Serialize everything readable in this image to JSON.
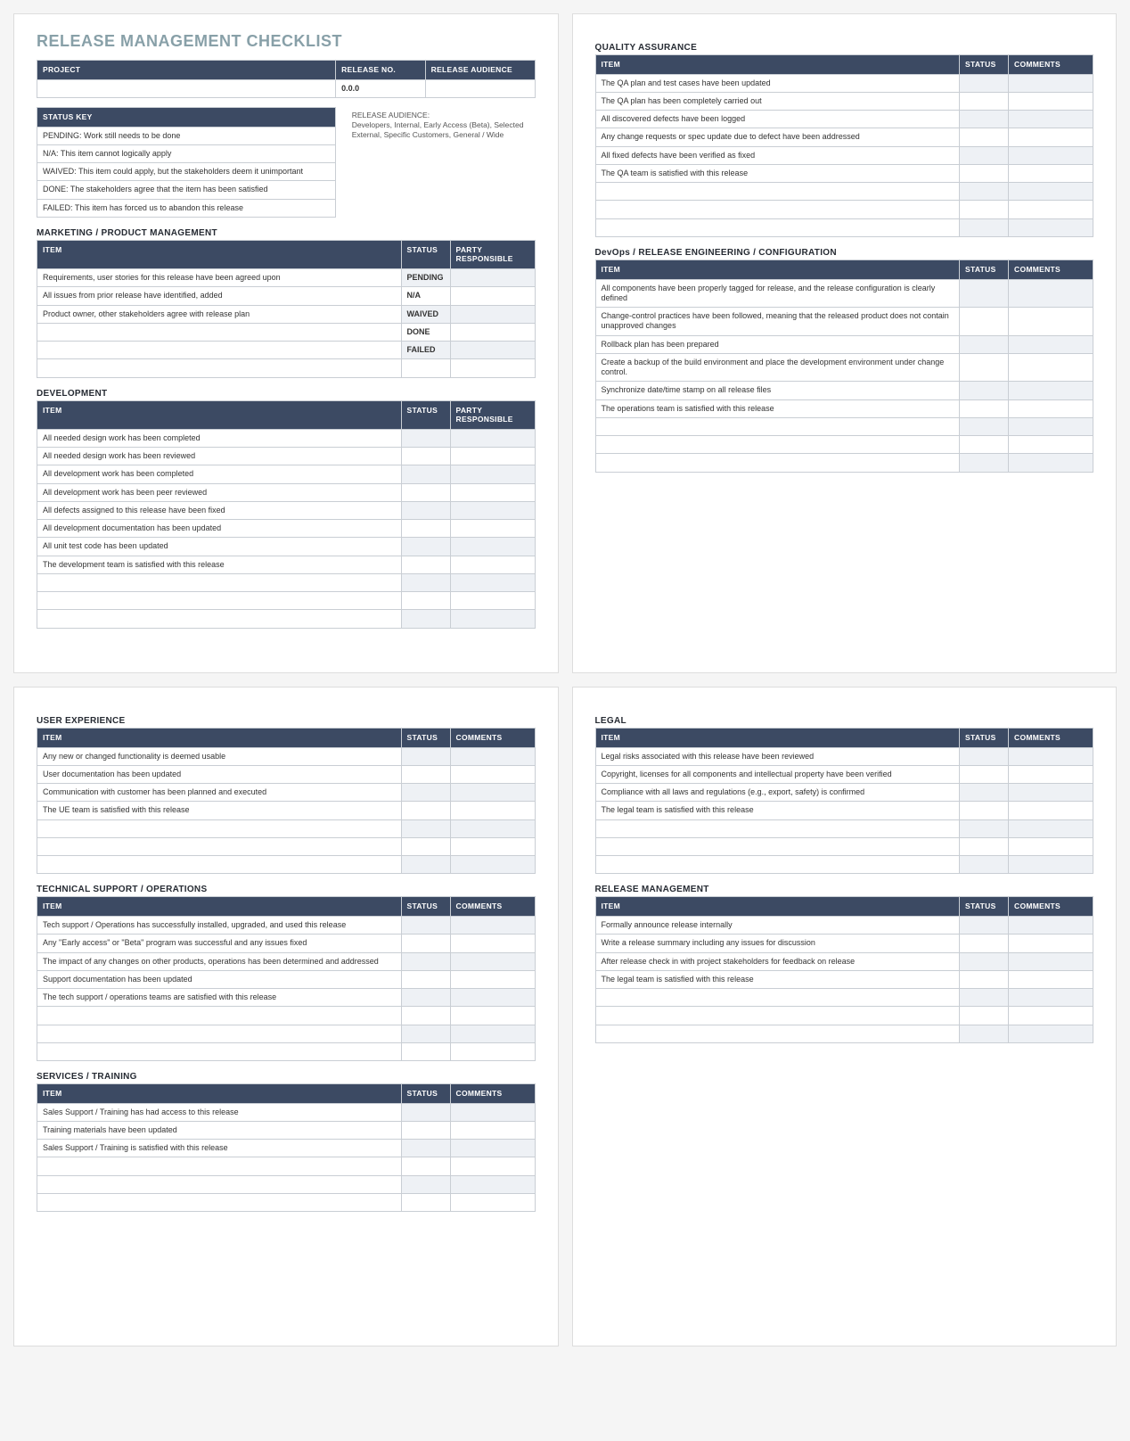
{
  "title": "RELEASE MANAGEMENT CHECKLIST",
  "project_table": {
    "headers": [
      "PROJECT",
      "RELEASE NO.",
      "RELEASE AUDIENCE"
    ],
    "row": [
      "",
      "0.0.0",
      ""
    ]
  },
  "status_key": {
    "header": "STATUS KEY",
    "rows": [
      "PENDING:  Work still needs to be done",
      "N/A:  This item cannot logically apply",
      "WAIVED:  This item could apply, but the stakeholders deem it unimportant",
      "DONE:  The stakeholders agree that the item has been satisfied",
      "FAILED:  This item has forced us to abandon this release"
    ]
  },
  "release_audience_note_label": "RELEASE AUDIENCE:",
  "release_audience_note": "Developers, Internal, Early Access (Beta), Selected External, Specific Customers, General / Wide",
  "col_item": "ITEM",
  "col_status": "STATUS",
  "col_party": "PARTY RESPONSIBLE",
  "col_comments": "COMMENTS",
  "sections": {
    "marketing": {
      "title": "MARKETING / PRODUCT MANAGEMENT",
      "third_col": "party",
      "rows": [
        [
          "Requirements, user stories for this release have been agreed upon",
          "PENDING",
          ""
        ],
        [
          "All issues from prior release have identified, added",
          "N/A",
          ""
        ],
        [
          "Product owner, other stakeholders agree with release plan",
          "WAIVED",
          ""
        ],
        [
          "",
          "DONE",
          ""
        ],
        [
          "",
          "FAILED",
          ""
        ],
        [
          "",
          "",
          ""
        ]
      ]
    },
    "development": {
      "title": "DEVELOPMENT",
      "third_col": "party",
      "rows": [
        [
          "All needed design work has been completed",
          "",
          ""
        ],
        [
          "All needed design work has been reviewed",
          "",
          ""
        ],
        [
          "All development work has been completed",
          "",
          ""
        ],
        [
          "All development work has been peer reviewed",
          "",
          ""
        ],
        [
          "All defects assigned to this release have been fixed",
          "",
          ""
        ],
        [
          "All development documentation has been updated",
          "",
          ""
        ],
        [
          "All unit test code has been updated",
          "",
          ""
        ],
        [
          "The development team is satisfied with this release",
          "",
          ""
        ],
        [
          "",
          "",
          ""
        ],
        [
          "",
          "",
          ""
        ],
        [
          "",
          "",
          ""
        ]
      ]
    },
    "qa": {
      "title": "QUALITY ASSURANCE",
      "third_col": "comments",
      "rows": [
        [
          "The QA plan and test cases have been updated",
          "",
          ""
        ],
        [
          "The QA plan has been completely carried out",
          "",
          ""
        ],
        [
          "All discovered defects have been logged",
          "",
          ""
        ],
        [
          "Any change requests or spec update due to defect have been addressed",
          "",
          ""
        ],
        [
          "All fixed defects have been verified as fixed",
          "",
          ""
        ],
        [
          "The QA team is satisfied with this release",
          "",
          ""
        ],
        [
          "",
          "",
          ""
        ],
        [
          "",
          "",
          ""
        ],
        [
          "",
          "",
          ""
        ]
      ]
    },
    "devops": {
      "title": "DevOps / RELEASE ENGINEERING / CONFIGURATION",
      "third_col": "comments",
      "rows": [
        [
          "All components have been properly tagged for release, and the release configuration is clearly defined",
          "",
          ""
        ],
        [
          "Change-control practices have been followed, meaning that the released product does not contain unapproved changes",
          "",
          ""
        ],
        [
          "Rollback plan has been prepared",
          "",
          ""
        ],
        [
          "Create a backup of the build environment and place the development environment under change control.",
          "",
          ""
        ],
        [
          "Synchronize date/time stamp on all release files",
          "",
          ""
        ],
        [
          "The operations team is satisfied with this release",
          "",
          ""
        ],
        [
          "",
          "",
          ""
        ],
        [
          "",
          "",
          ""
        ],
        [
          "",
          "",
          ""
        ]
      ]
    },
    "ux": {
      "title": "USER EXPERIENCE",
      "third_col": "comments",
      "rows": [
        [
          "Any new or changed functionality is deemed usable",
          "",
          ""
        ],
        [
          "User documentation has been updated",
          "",
          ""
        ],
        [
          "Communication with customer has been planned and executed",
          "",
          ""
        ],
        [
          "The UE team is satisfied with this release",
          "",
          ""
        ],
        [
          "",
          "",
          ""
        ],
        [
          "",
          "",
          ""
        ],
        [
          "",
          "",
          ""
        ]
      ]
    },
    "techsupport": {
      "title": "TECHNICAL SUPPORT / OPERATIONS",
      "third_col": "comments",
      "rows": [
        [
          "Tech support / Operations has successfully installed, upgraded, and used this release",
          "",
          ""
        ],
        [
          "Any \"Early access\" or \"Beta\" program was successful and any issues fixed",
          "",
          ""
        ],
        [
          "The impact of any changes on other products, operations has been determined and addressed",
          "",
          ""
        ],
        [
          "Support documentation has been updated",
          "",
          ""
        ],
        [
          "The tech support / operations teams are satisfied with this release",
          "",
          ""
        ],
        [
          "",
          "",
          ""
        ],
        [
          "",
          "",
          ""
        ],
        [
          "",
          "",
          ""
        ]
      ]
    },
    "services": {
      "title": "SERVICES / TRAINING",
      "third_col": "comments",
      "rows": [
        [
          "Sales Support / Training has had access to this release",
          "",
          ""
        ],
        [
          "Training materials have been updated",
          "",
          ""
        ],
        [
          "Sales Support / Training is satisfied with this release",
          "",
          ""
        ],
        [
          "",
          "",
          ""
        ],
        [
          "",
          "",
          ""
        ],
        [
          "",
          "",
          ""
        ]
      ]
    },
    "legal": {
      "title": "LEGAL",
      "third_col": "comments",
      "rows": [
        [
          "Legal risks associated with this release have been reviewed",
          "",
          ""
        ],
        [
          "Copyright, licenses for all components and intellectual property have been verified",
          "",
          ""
        ],
        [
          "Compliance with all laws and regulations (e.g., export, safety) is confirmed",
          "",
          ""
        ],
        [
          "The legal team is satisfied with this release",
          "",
          ""
        ],
        [
          "",
          "",
          ""
        ],
        [
          "",
          "",
          ""
        ],
        [
          "",
          "",
          ""
        ]
      ]
    },
    "releasemgmt": {
      "title": "RELEASE MANAGEMENT",
      "third_col": "comments",
      "rows": [
        [
          "Formally announce release internally",
          "",
          ""
        ],
        [
          "Write a release summary including any issues for discussion",
          "",
          ""
        ],
        [
          "After release check in with project stakeholders for feedback on release",
          "",
          ""
        ],
        [
          "The legal team is satisfied with this release",
          "",
          ""
        ],
        [
          "",
          "",
          ""
        ],
        [
          "",
          "",
          ""
        ],
        [
          "",
          "",
          ""
        ]
      ]
    }
  }
}
